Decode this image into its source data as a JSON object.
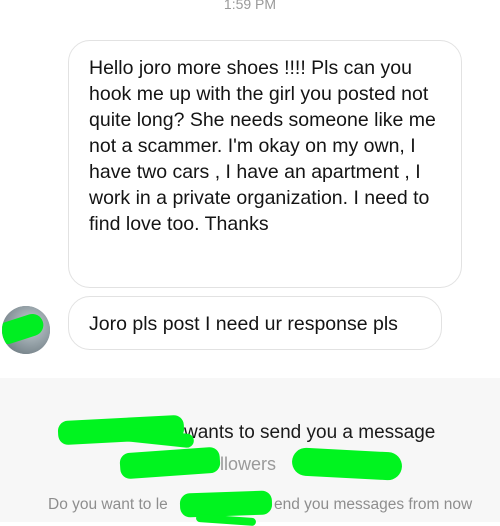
{
  "status": {
    "time": "1:59 PM"
  },
  "messages": [
    {
      "text": "Hello joro more shoes !!!! Pls can you hook me up with the girl you posted not quite long? She needs someone like me not a scammer. I'm okay on my own, I have two cars , I have an apartment , I work in a private organization. I need to find love too. Thanks"
    },
    {
      "text": "Joro pls post I need ur response pls"
    }
  ],
  "request_panel": {
    "wants_text": "wants to send you a message",
    "followers_text": "llowers",
    "prompt_start": "Do you want to le",
    "prompt_end": "end you messages from now"
  },
  "colors": {
    "redaction": "#00f41f",
    "panel_bg": "#f7f7f7",
    "bubble_border": "#e2e2e2"
  }
}
